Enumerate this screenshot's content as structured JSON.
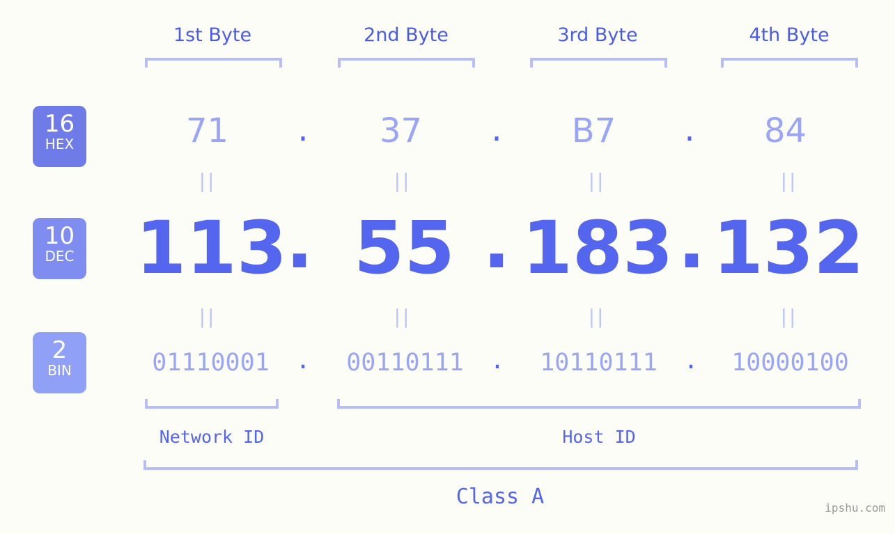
{
  "title": "IP Address Byte Breakdown",
  "background_color": "#fcfdf7",
  "colors": {
    "header_text": "#4a5bea",
    "bracket": "#b6bdf7",
    "hex_value": "#9aa6f5",
    "dec_value": "#5566ee",
    "bin_value": "#9aa6f5",
    "badge_hex": "#6f7ce8",
    "badge_dec": "#7f8df0",
    "badge_bin": "#8fa0f6",
    "watermark": "#9a9a9a"
  },
  "byte_headers": [
    {
      "label": "1st Byte"
    },
    {
      "label": "2nd Byte"
    },
    {
      "label": "3rd Byte"
    },
    {
      "label": "4th Byte"
    }
  ],
  "bases": [
    {
      "number": "16",
      "name": "HEX"
    },
    {
      "number": "10",
      "name": "DEC"
    },
    {
      "number": "2",
      "name": "BIN"
    }
  ],
  "rows": {
    "hex": {
      "base_number": "16",
      "base_name": "HEX",
      "values": [
        "71",
        "37",
        "B7",
        "84"
      ],
      "separator": "."
    },
    "dec": {
      "base_number": "10",
      "base_name": "DEC",
      "values": [
        "113",
        "55",
        "183",
        "132"
      ],
      "separator": "."
    },
    "bin": {
      "base_number": "2",
      "base_name": "BIN",
      "values": [
        "01110001",
        "00110111",
        "10110111",
        "10000100"
      ],
      "separator": "."
    }
  },
  "equals_marks": {
    "glyph": "||",
    "count_per_row": 4,
    "rows": 2
  },
  "segments": {
    "network_id": "Network ID",
    "host_id": "Host ID",
    "class": "Class A"
  },
  "watermark": "ipshu.com"
}
